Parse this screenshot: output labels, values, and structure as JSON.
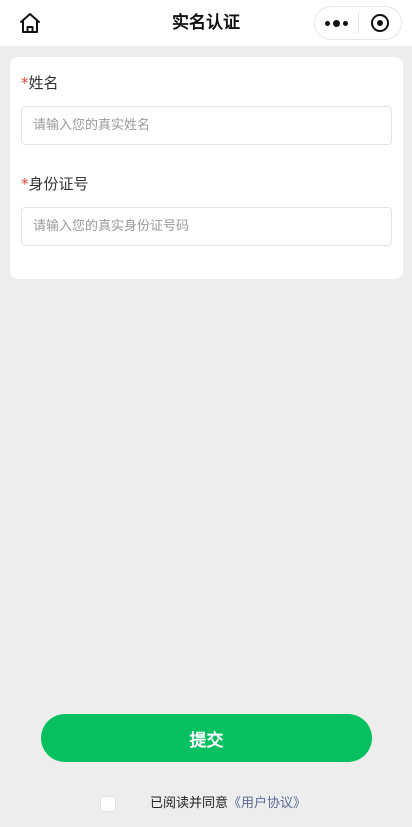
{
  "navbar": {
    "title": "实名认证",
    "home_icon": "home-icon",
    "more_icon": "more-dots-icon",
    "close_icon": "target-circle-icon"
  },
  "form": {
    "required_mark": "*",
    "name_label": "姓名",
    "name_placeholder": "请输入您的真实姓名",
    "id_label": "身份证号",
    "id_placeholder": "请输入您的真实身份证号码"
  },
  "submit_label": "提交",
  "agreement": {
    "text": "已阅读并同意",
    "link_text": "《用户协议》"
  },
  "colors": {
    "primary": "#07c160",
    "required": "#e64340",
    "link": "#576b95",
    "background": "#ededed"
  }
}
